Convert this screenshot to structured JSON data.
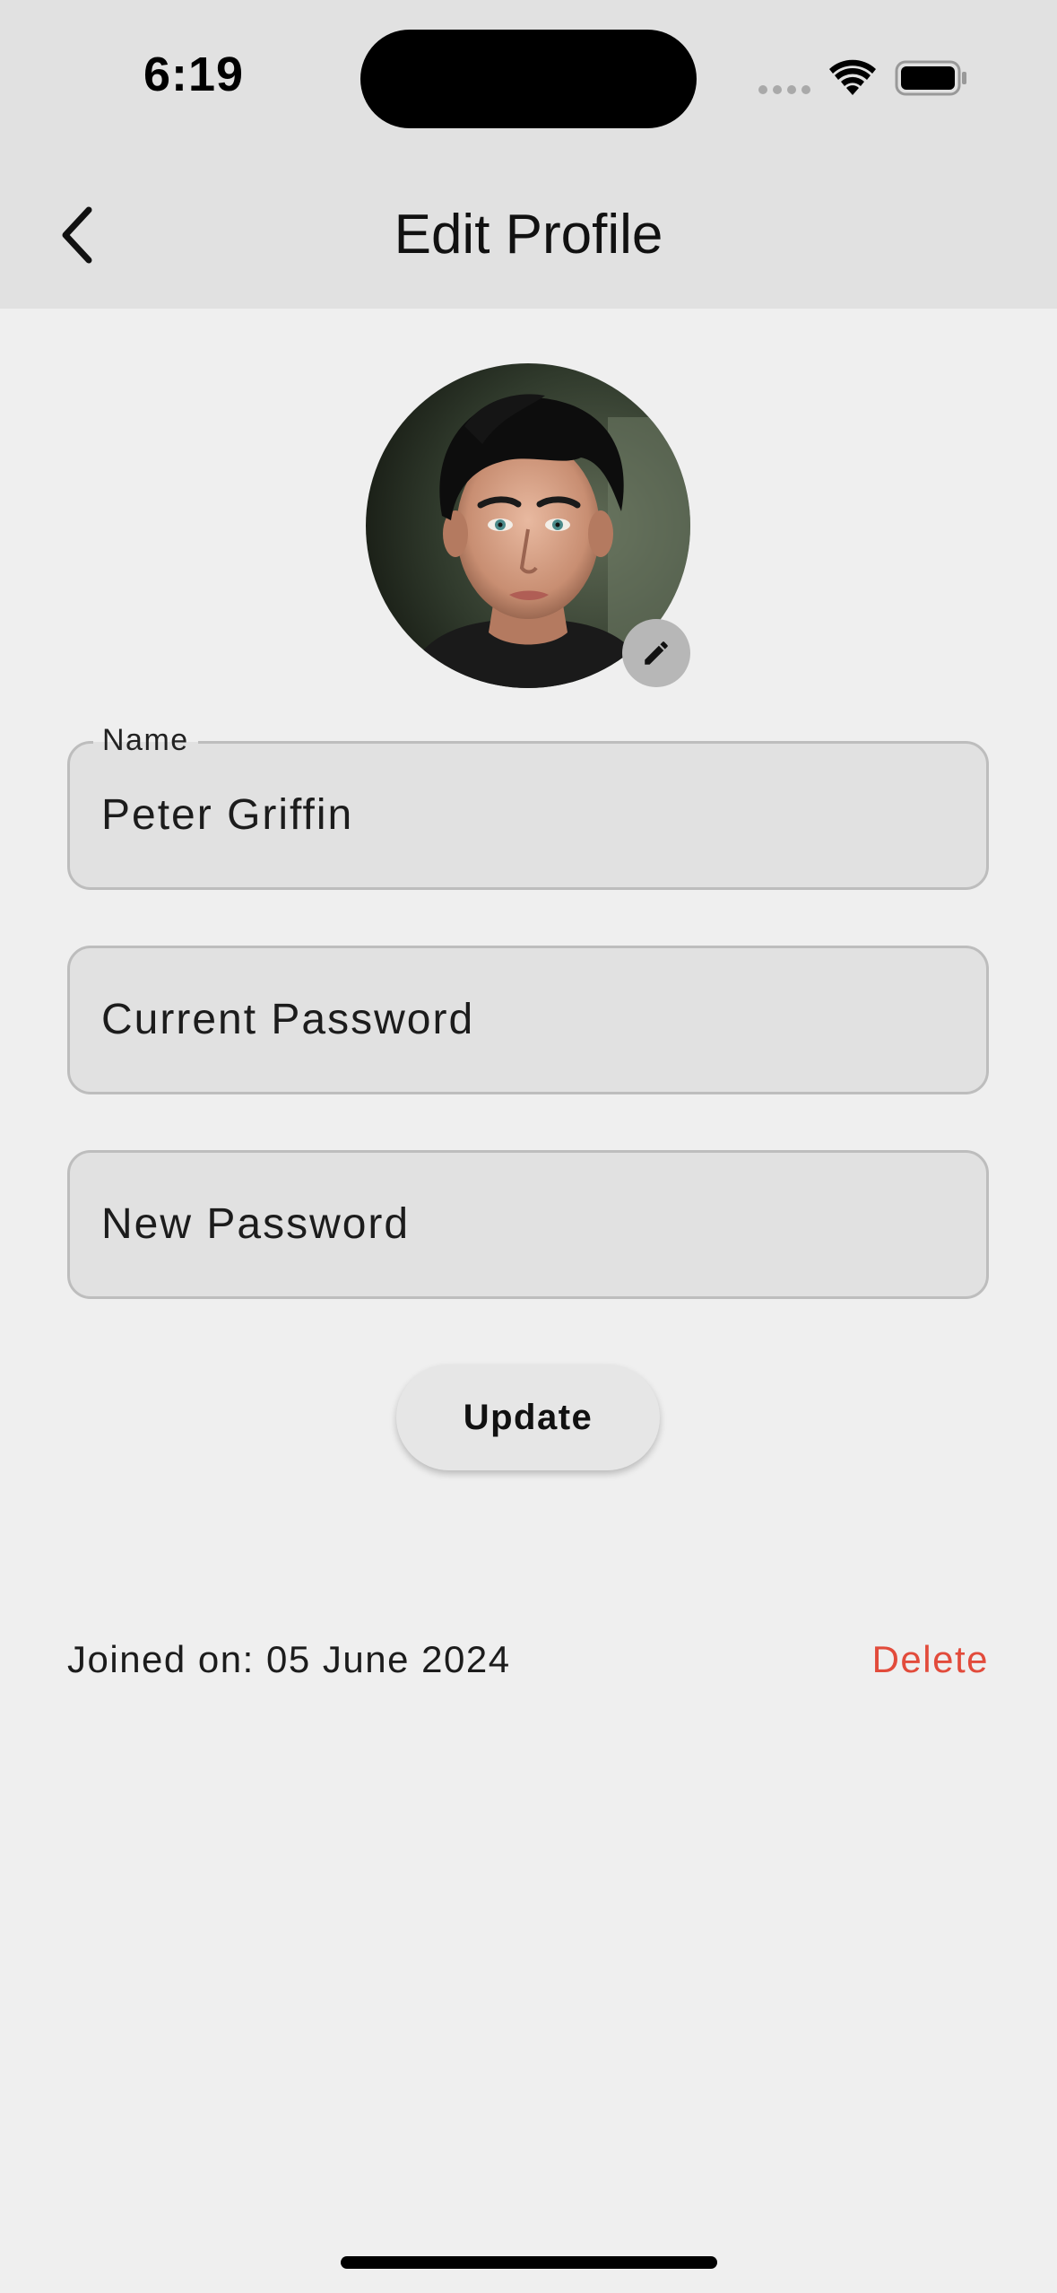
{
  "status_bar": {
    "time": "6:19"
  },
  "app_bar": {
    "title": "Edit Profile",
    "back_icon": "chevron-left-icon"
  },
  "profile": {
    "avatar_alt": "profile-photo",
    "edit_icon": "pencil-icon"
  },
  "form": {
    "name_label": "Name",
    "name_value": "Peter Griffin",
    "current_password_placeholder": "Current Password",
    "new_password_placeholder": "New Password",
    "update_label": "Update"
  },
  "footer": {
    "joined_text": "Joined on: 05 June 2024",
    "delete_label": "Delete"
  },
  "colors": {
    "background": "#efefef",
    "app_bar": "#e1e1e1",
    "field_background": "#e1e1e1",
    "field_border": "#bdbdbd",
    "delete": "#e24b3b",
    "edit_badge": "#b7b7b7"
  }
}
